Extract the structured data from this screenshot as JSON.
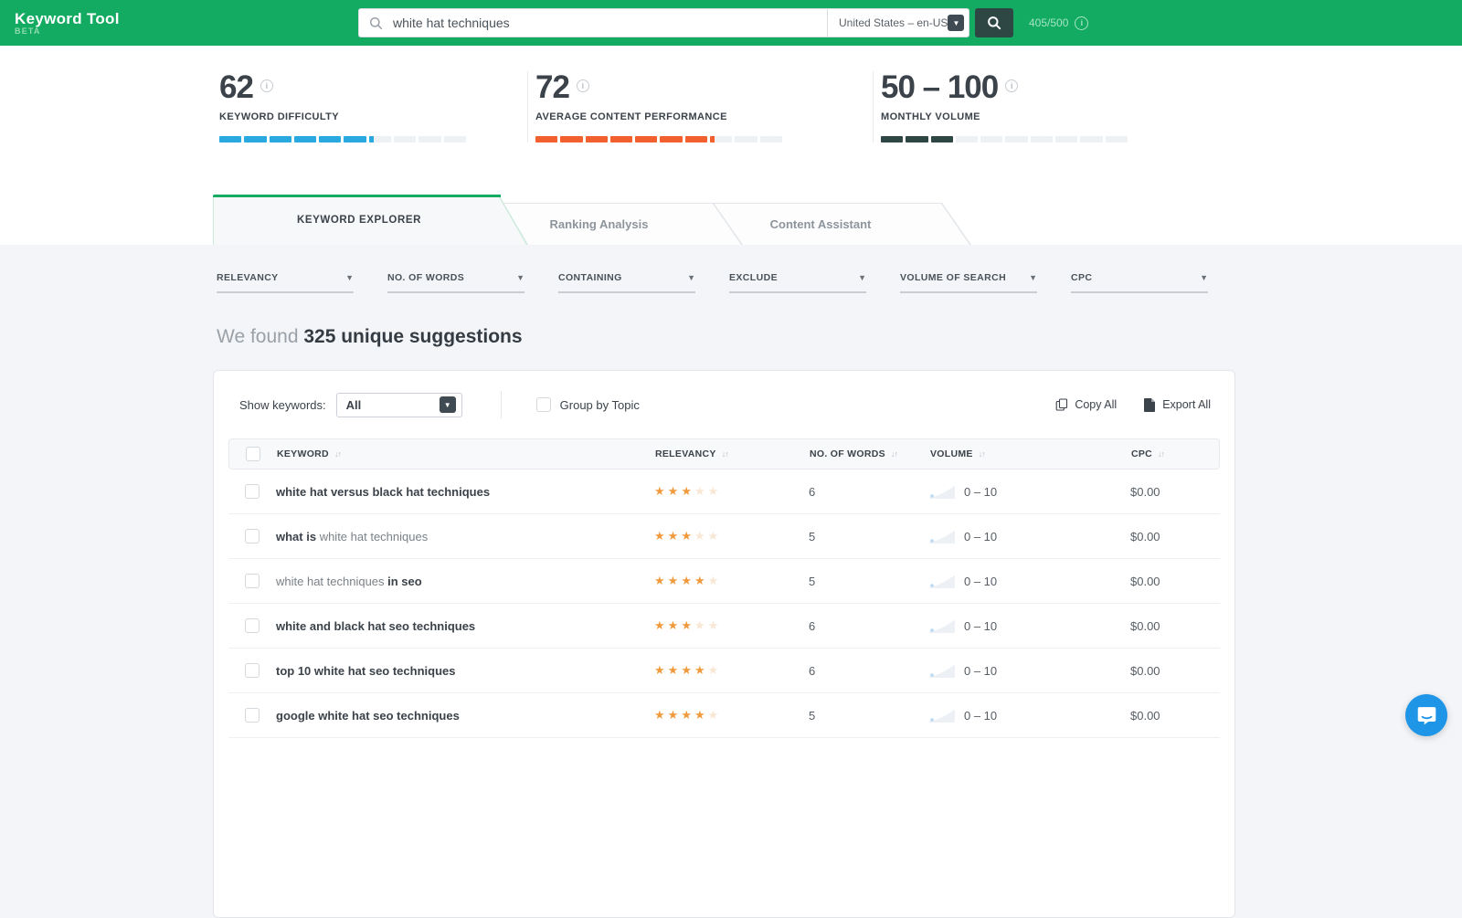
{
  "header": {
    "logo_title": "Keyword Tool",
    "logo_badge": "BETA",
    "search_value": "white hat techniques",
    "region_value": "United States – en-US",
    "quota": "405/500",
    "brand_green": "#12ab61",
    "dark_button": "#2e4744"
  },
  "metrics": {
    "items": [
      {
        "value": "62",
        "label": "KEYWORD DIFFICULTY",
        "fill": 6.2,
        "color": "#29a9e0"
      },
      {
        "value": "72",
        "label": "AVERAGE CONTENT PERFORMANCE",
        "fill": 7.2,
        "color": "#f1602e"
      },
      {
        "value": "50 – 100",
        "label": "MONTHLY VOLUME",
        "fill": 3,
        "color": "#2e4744"
      }
    ],
    "segments_total": 10,
    "empty_color": "#eef1f4"
  },
  "tabs": {
    "items": [
      {
        "label": "KEYWORD EXPLORER",
        "active": true
      },
      {
        "label": "Ranking Analysis",
        "active": false
      },
      {
        "label": "Content Assistant",
        "active": false
      }
    ]
  },
  "filters": {
    "items": [
      "RELEVANCY",
      "NO. OF WORDS",
      "CONTAINING",
      "EXCLUDE",
      "VOLUME OF SEARCH",
      "CPC"
    ],
    "caret": "▼"
  },
  "results_heading": {
    "prefix": "We found ",
    "bold": "325 unique suggestions"
  },
  "toolbar": {
    "show_keywords_label": "Show keywords:",
    "show_keywords_value": "All",
    "group_by_topic_label": "Group by Topic",
    "copy_all_label": "Copy All",
    "export_all_label": "Export All"
  },
  "table": {
    "headers": [
      "KEYWORD",
      "RELEVANCY",
      "NO. OF WORDS",
      "VOLUME",
      "CPC"
    ],
    "star_on_color": "#f09a3e",
    "star_off_color": "#f8e7d4",
    "rows": [
      {
        "parts": [
          {
            "t": "white hat versus black hat techniques",
            "b": true
          }
        ],
        "stars": 3,
        "words": "6",
        "volume": "0 – 10",
        "cpc": "$0.00"
      },
      {
        "parts": [
          {
            "t": "what is ",
            "b": true
          },
          {
            "t": "white hat techniques",
            "b": false
          }
        ],
        "stars": 3,
        "words": "5",
        "volume": "0 – 10",
        "cpc": "$0.00"
      },
      {
        "parts": [
          {
            "t": "white hat techniques ",
            "b": false
          },
          {
            "t": "in seo",
            "b": true
          }
        ],
        "stars": 4,
        "words": "5",
        "volume": "0 – 10",
        "cpc": "$0.00"
      },
      {
        "parts": [
          {
            "t": "white and black hat seo techniques",
            "b": true
          }
        ],
        "stars": 3,
        "words": "6",
        "volume": "0 – 10",
        "cpc": "$0.00"
      },
      {
        "parts": [
          {
            "t": "top 10 white hat seo techniques",
            "b": true
          }
        ],
        "stars": 4,
        "words": "6",
        "volume": "0 – 10",
        "cpc": "$0.00"
      },
      {
        "parts": [
          {
            "t": "google white hat seo techniques",
            "b": true
          }
        ],
        "stars": 4,
        "words": "5",
        "volume": "0 – 10",
        "cpc": "$0.00"
      }
    ]
  }
}
